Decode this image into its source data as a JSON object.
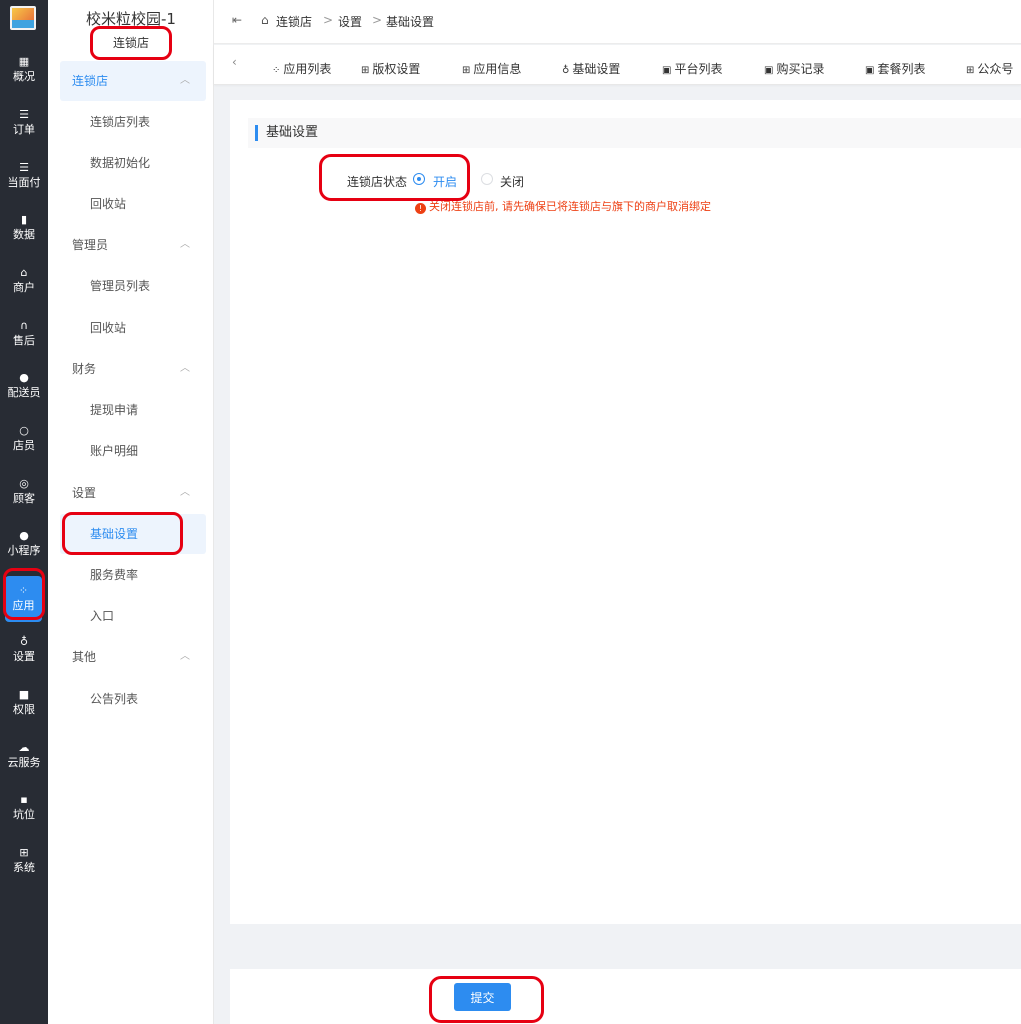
{
  "rail": {
    "items": [
      {
        "label": "概况",
        "icon": "overview-icon"
      },
      {
        "label": "订单",
        "icon": "list-icon"
      },
      {
        "label": "当面付",
        "icon": "list-icon"
      },
      {
        "label": "数据",
        "icon": "chart-icon"
      },
      {
        "label": "商户",
        "icon": "store-icon"
      },
      {
        "label": "售后",
        "icon": "headset-icon"
      },
      {
        "label": "配送员",
        "icon": "scooter-icon"
      },
      {
        "label": "店员",
        "icon": "user-icon"
      },
      {
        "label": "顾客",
        "icon": "customer-icon"
      },
      {
        "label": "小程序",
        "icon": "wechat-icon"
      },
      {
        "label": "应用",
        "icon": "apps-icon"
      },
      {
        "label": "设置",
        "icon": "settings-icon"
      },
      {
        "label": "权限",
        "icon": "lock-icon"
      },
      {
        "label": "云服务",
        "icon": "cloud-icon"
      },
      {
        "label": "坑位",
        "icon": "slot-icon"
      },
      {
        "label": "系统",
        "icon": "windows-icon"
      }
    ]
  },
  "sidebar": {
    "title": "校米粒校园-1",
    "subtitle": "连锁店",
    "groups": [
      {
        "label": "连锁店",
        "items": [
          "连锁店列表",
          "数据初始化",
          "回收站"
        ]
      },
      {
        "label": "管理员",
        "items": [
          "管理员列表",
          "回收站"
        ]
      },
      {
        "label": "财务",
        "items": [
          "提现申请",
          "账户明细"
        ]
      },
      {
        "label": "设置",
        "items": [
          "基础设置",
          "服务费率",
          "入口"
        ]
      },
      {
        "label": "其他",
        "items": [
          "公告列表"
        ]
      }
    ]
  },
  "breadcrumb": [
    "连锁店",
    "设置",
    "基础设置"
  ],
  "tabs": [
    "应用列表",
    "版权设置",
    "应用信息",
    "基础设置",
    "平台列表",
    "购买记录",
    "套餐列表",
    "公众号"
  ],
  "form": {
    "section_title": "基础设置",
    "field_label": "连锁店状态",
    "options": [
      "开启",
      "关闭"
    ],
    "selected": "开启",
    "hint": "关闭连锁店前, 请先确保已将连锁店与旗下的商户取消绑定"
  },
  "submit_label": "提交",
  "colors": {
    "accent": "#2d8cf0",
    "rail": "#282c34",
    "error": "#ed4014",
    "annotation": "#e60012"
  }
}
